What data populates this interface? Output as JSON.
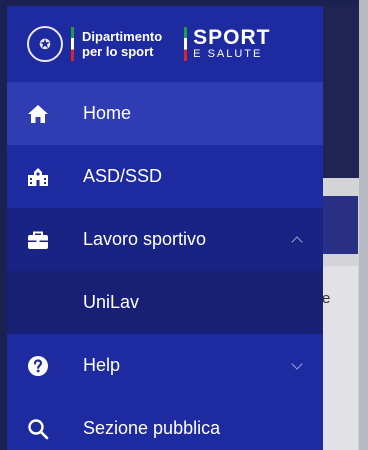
{
  "branding": {
    "dept_line1": "Dipartimento",
    "dept_line2": "per lo sport",
    "sport_main": "SPORT",
    "sport_sub": "E SALUTE"
  },
  "menu": {
    "home": {
      "label": "Home",
      "icon": "home-icon",
      "state": "active"
    },
    "asd": {
      "label": "ASD/SSD",
      "icon": "building-icon"
    },
    "lavoro": {
      "label": "Lavoro sportivo",
      "icon": "briefcase-icon",
      "state": "expanded"
    },
    "unilav": {
      "label": "UniLav"
    },
    "help": {
      "label": "Help",
      "icon": "help-circle-icon",
      "state": "collapsed"
    },
    "sezione": {
      "label": "Sezione pubblica",
      "icon": "search-icon"
    }
  },
  "background": {
    "peek_text": "e"
  },
  "colors": {
    "drawer": "#1d2aa0",
    "active_item": "#2f3cb2",
    "expanded_item": "#192383",
    "sub_item": "#172075"
  }
}
